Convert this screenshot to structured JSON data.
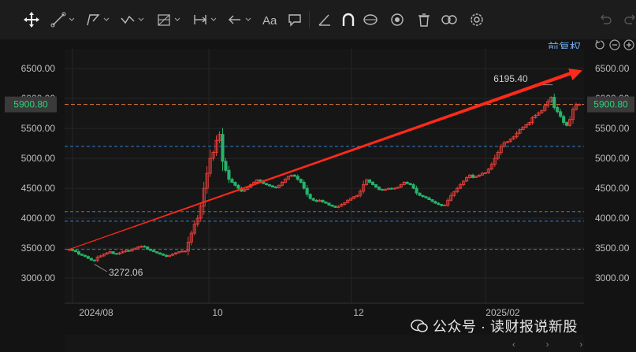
{
  "toolbar": {
    "icons": [
      "crosshair-icon",
      "trend-line-icon",
      "polyline-icon",
      "zigzag-icon",
      "fib-grid-icon",
      "measure-icon",
      "arrow-icon",
      "text-icon",
      "comment-icon",
      "ruler-icon",
      "magnet-icon",
      "lock-draw-icon",
      "eye-icon",
      "trash-icon",
      "link-icon",
      "settings-icon",
      "undo-icon",
      "redo-icon"
    ]
  },
  "adjust_label": "前复权",
  "watermark": "公众号 · 读财报说新股",
  "colors": {
    "up": "#e8403a",
    "down": "#27b36a",
    "bg": "#131313",
    "grid": "#262626",
    "hline": "#2f7fd0",
    "price_line": "#e07a3a",
    "arrow": "#ff2a1a"
  },
  "chart_data": {
    "type": "candlestick",
    "x_ticks": [
      "2024/08",
      "10",
      "12",
      "2025/02"
    ],
    "y_ticks": [
      "6500.00",
      "6000.00",
      "5500.00",
      "5000.00",
      "4500.00",
      "4000.00",
      "3500.00",
      "3000.00"
    ],
    "ylim": [
      2580,
      6830
    ],
    "current_price": "5900.80",
    "annotations": {
      "high": "6195.40",
      "low": "3272.06"
    },
    "horizontal_levels": [
      5200,
      4110,
      3950,
      3480
    ],
    "trend_arrow": {
      "from": [
        0,
        3480
      ],
      "to": [
        165,
        6470
      ]
    },
    "closes": [
      3480,
      3460,
      3440,
      3400,
      3380,
      3360,
      3330,
      3300,
      3290,
      3350,
      3370,
      3400,
      3420,
      3440,
      3410,
      3400,
      3420,
      3440,
      3460,
      3450,
      3480,
      3500,
      3520,
      3530,
      3520,
      3480,
      3460,
      3440,
      3420,
      3400,
      3380,
      3360,
      3380,
      3400,
      3420,
      3440,
      3450,
      3450,
      3600,
      3750,
      3900,
      4000,
      4200,
      4500,
      4750,
      5000,
      5100,
      5300,
      5400,
      4950,
      4800,
      4650,
      4600,
      4550,
      4500,
      4450,
      4480,
      4520,
      4560,
      4600,
      4640,
      4620,
      4580,
      4560,
      4540,
      4520,
      4510,
      4550,
      4600,
      4650,
      4700,
      4720,
      4700,
      4650,
      4600,
      4500,
      4400,
      4330,
      4300,
      4280,
      4300,
      4270,
      4250,
      4220,
      4200,
      4180,
      4200,
      4230,
      4260,
      4300,
      4330,
      4360,
      4380,
      4450,
      4560,
      4640,
      4600,
      4560,
      4520,
      4480,
      4470,
      4480,
      4500,
      4490,
      4500,
      4520,
      4560,
      4600,
      4580,
      4560,
      4500,
      4420,
      4380,
      4360,
      4340,
      4310,
      4280,
      4250,
      4230,
      4210,
      4220,
      4300,
      4380,
      4440,
      4500,
      4560,
      4620,
      4680,
      4720,
      4680,
      4700,
      4720,
      4750,
      4760,
      4820,
      4900,
      5000,
      5100,
      5200,
      5260,
      5280,
      5320,
      5360,
      5420,
      5480,
      5520,
      5560,
      5600,
      5680,
      5720,
      5760,
      5800,
      5880,
      5950,
      6020,
      5850,
      5780,
      5700,
      5600,
      5550,
      5650,
      5820,
      5900,
      5900.8
    ]
  }
}
